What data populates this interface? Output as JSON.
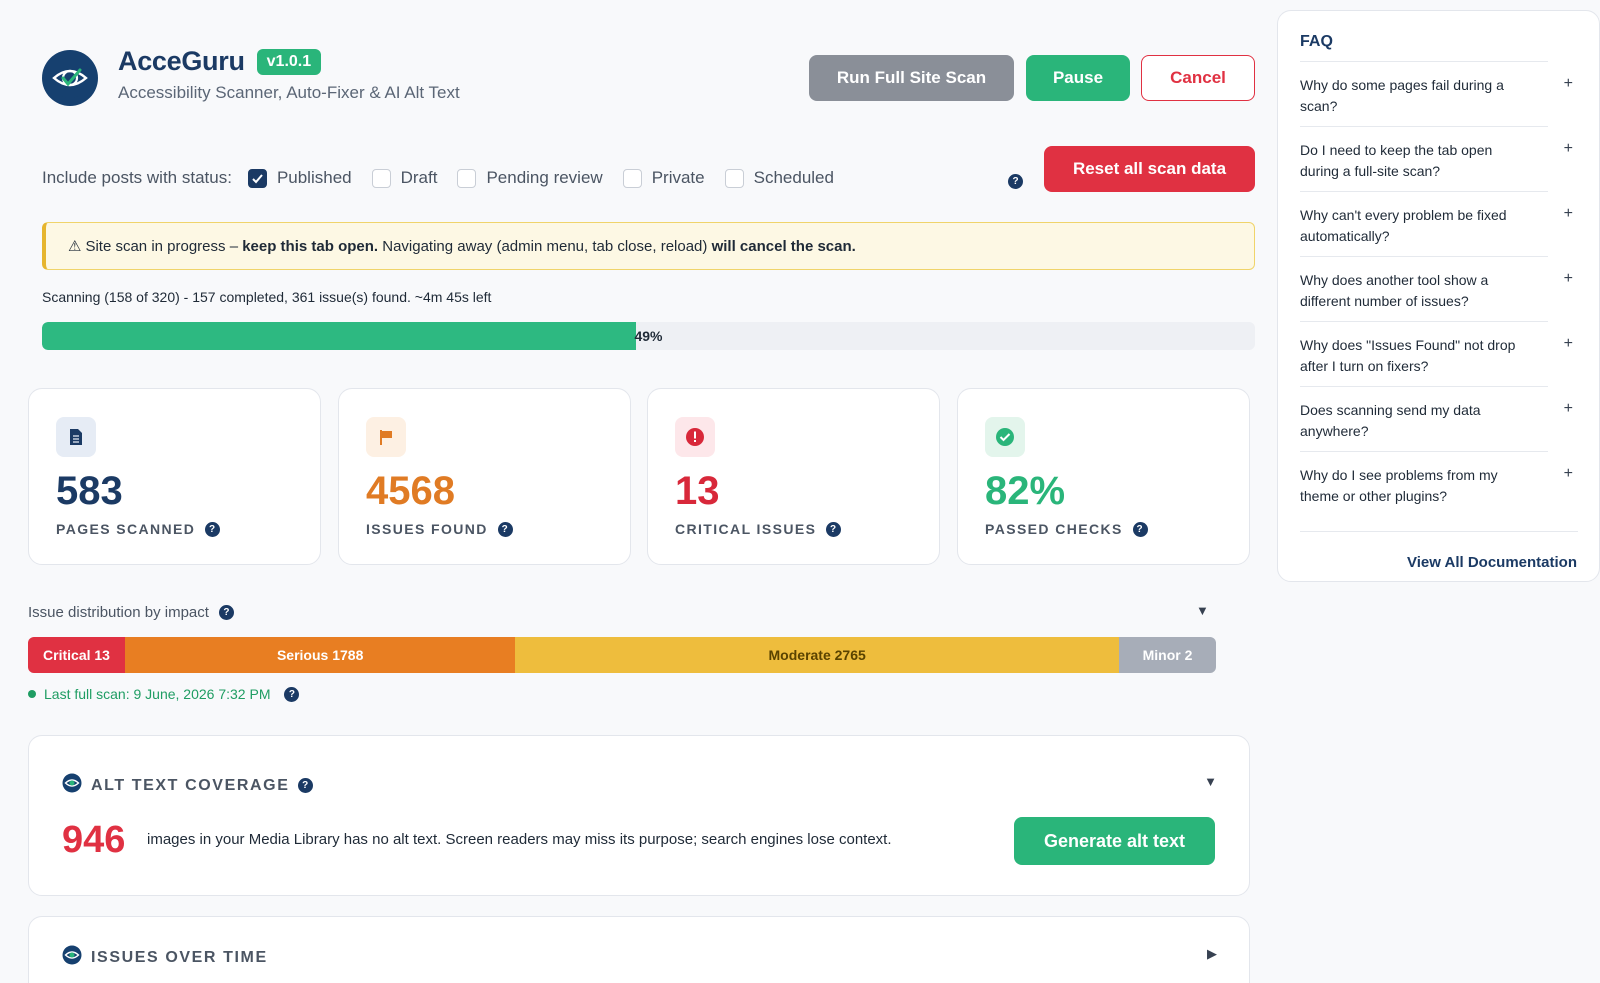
{
  "header": {
    "title": "AcceGuru",
    "version": "v1.0.1",
    "subtitle": "Accessibility Scanner, Auto-Fixer & AI Alt Text",
    "logo_icon": "eye-check-icon"
  },
  "actions": {
    "scan_label": "Run Full Site Scan",
    "pause_label": "Pause",
    "cancel_label": "Cancel",
    "reset_label": "Reset all scan data"
  },
  "status_filter": {
    "label": "Include posts with status:",
    "options": [
      {
        "label": "Published",
        "checked": true
      },
      {
        "label": "Draft",
        "checked": false
      },
      {
        "label": "Pending review",
        "checked": false
      },
      {
        "label": "Private",
        "checked": false
      },
      {
        "label": "Scheduled",
        "checked": false
      }
    ]
  },
  "warning": {
    "icon": "⚠",
    "prefix": "Site scan in progress – ",
    "bold1": "keep this tab open.",
    "middle": " Navigating away (admin menu, tab close, reload) ",
    "bold2": "will cancel the scan."
  },
  "scan_status": "Scanning (158 of 320) - 157 completed, 361 issue(s) found. ~4m 45s left",
  "progress": {
    "percent": 49,
    "label": "49%"
  },
  "stats": [
    {
      "value": "583",
      "label": "PAGES SCANNED",
      "color": "#1b3a64",
      "icon": "document-icon"
    },
    {
      "value": "4568",
      "label": "ISSUES FOUND",
      "color": "#e07b24",
      "icon": "flag-icon"
    },
    {
      "value": "13",
      "label": "CRITICAL ISSUES",
      "color": "#d8283a",
      "icon": "alert-icon"
    },
    {
      "value": "82%",
      "label": "PASSED CHECKS",
      "color": "#2ab57a",
      "icon": "check-circle-icon"
    }
  ],
  "distribution": {
    "title": "Issue distribution by impact",
    "segments": [
      {
        "label": "Critical 13",
        "count": 13,
        "color": "#e03142"
      },
      {
        "label": "Serious 1788",
        "count": 1788,
        "color": "#e87e22"
      },
      {
        "label": "Moderate 2765",
        "count": 2765,
        "color": "#eebd3d"
      },
      {
        "label": "Minor 2",
        "count": 2,
        "color": "#a7adb8"
      }
    ],
    "last_scan": "Last full scan: 9 June, 2026 7:32 PM"
  },
  "alt_text": {
    "title": "ALT TEXT COVERAGE",
    "count": "946",
    "description": "images in your Media Library has no alt text. Screen readers may miss its purpose; search engines lose context.",
    "button": "Generate alt text"
  },
  "issues_over_time": {
    "title": "ISSUES OVER TIME"
  },
  "faq": {
    "title": "FAQ",
    "items": [
      "Why do some pages fail during a scan?",
      "Do I need to keep the tab open during a full-site scan?",
      "Why can't every problem be fixed automatically?",
      "Why does another tool show a different number of issues?",
      "Why does \"Issues Found\" not drop after I turn on fixers?",
      "Does scanning send my data anywhere?",
      "Why do I see problems from my theme or other plugins?"
    ],
    "link": "View All Documentation"
  }
}
